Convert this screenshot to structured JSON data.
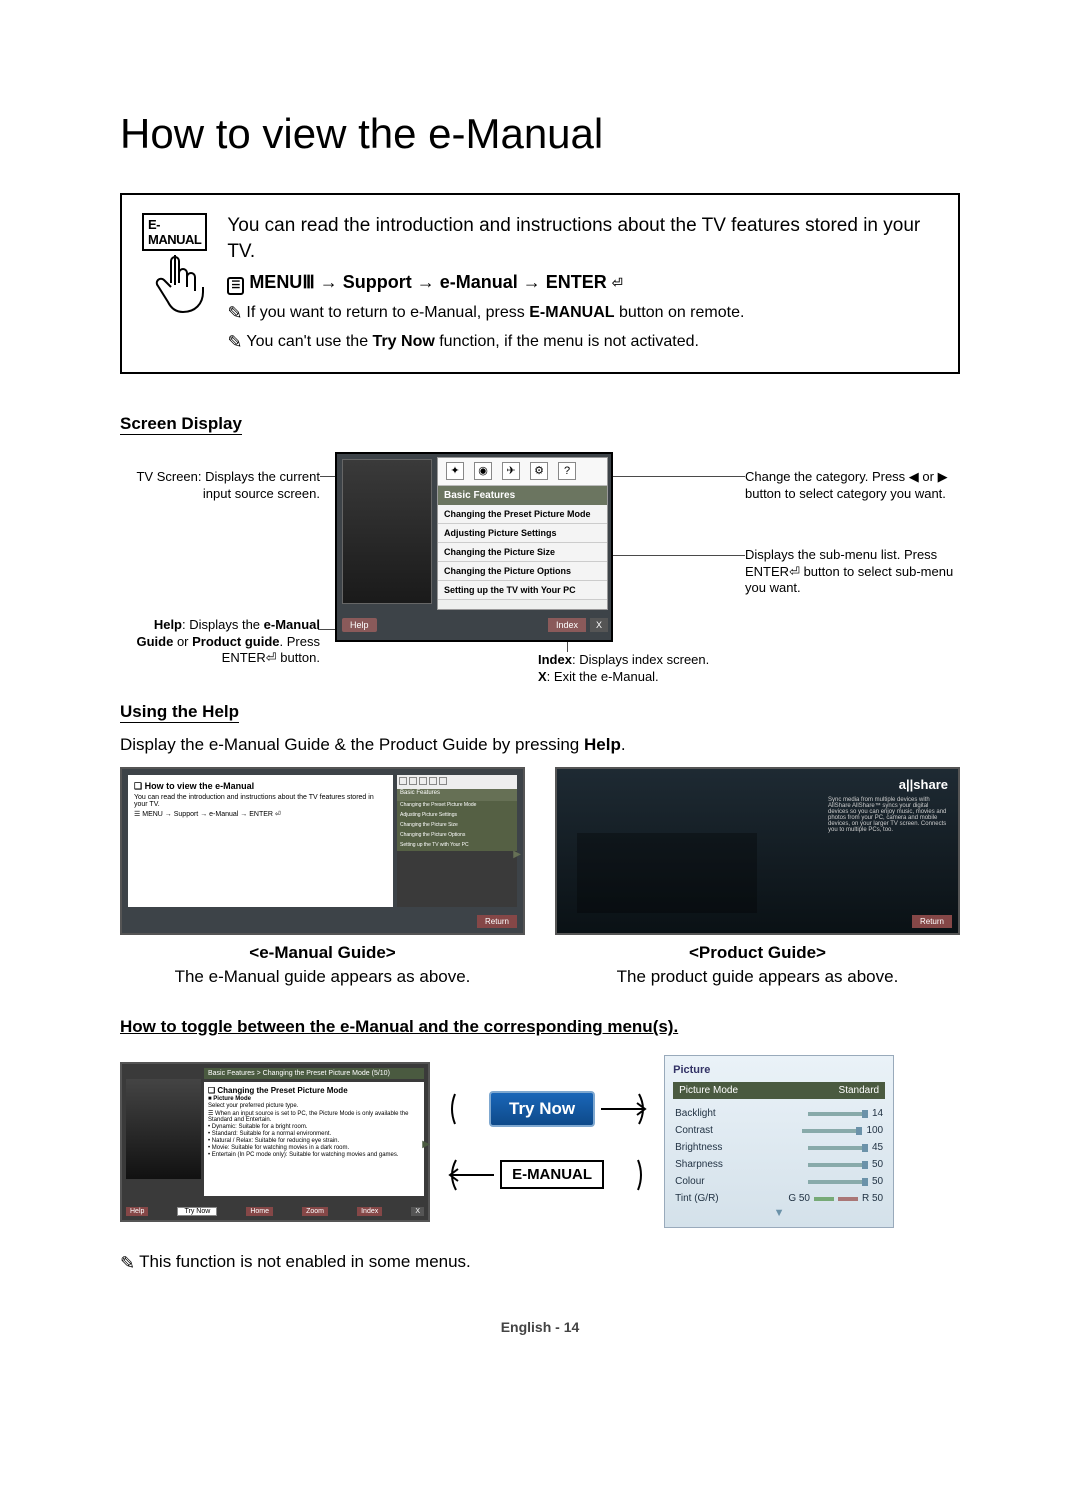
{
  "title": "How to view the e-Manual",
  "intro": {
    "badge": "E-MANUAL",
    "lead": "You can read the introduction and instructions about the TV features stored in your TV.",
    "path_menu": "MENU",
    "path_support": "Support",
    "path_emanual": "e-Manual",
    "path_enter": "ENTER",
    "note1_pre": "If you want to return to e-Manual, press ",
    "note1_b": "E-MANUAL",
    "note1_post": " button on remote.",
    "note2_pre": "You can't use the ",
    "note2_b": "Try Now",
    "note2_post": " function, if the menu is not activated."
  },
  "screen_display": {
    "heading": "Screen Display",
    "tvscreen_caption": "TV Screen: Displays the current input source screen.",
    "change_caption": "Change the category. Press ◀ or ▶ button to select category you want.",
    "submenu_caption_pre": "Displays the sub-menu list. Press ENTER",
    "submenu_caption_post": " button to select sub-menu you want.",
    "help_caption_html": [
      "Help",
      ": Displays the ",
      "e-Manual Guide",
      " or ",
      "Product guide",
      ". Press ENTER",
      " button."
    ],
    "index_caption_b": "Index",
    "index_caption": ": Displays index screen.",
    "x_caption_b": "X",
    "x_caption": ": Exit the e-Manual.",
    "bf_label": "Basic Features",
    "submenu_items": [
      "Changing the Preset Picture Mode",
      "Adjusting Picture Settings",
      "Changing the Picture Size",
      "Changing the Picture Options",
      "Setting up the TV with Your PC"
    ],
    "help_btn": "Help",
    "index_btn": "Index",
    "x_btn": "X"
  },
  "using_help": {
    "heading": "Using the Help",
    "desc_pre": "Display the e-Manual Guide & the Product Guide by pressing ",
    "desc_b": "Help",
    "desc_post": ".",
    "emg": {
      "box_title": "❏ How to view the e-Manual",
      "box_body": "You can read the introduction and instructions about the TV features stored in your TV.",
      "box_path": "MENU → Support → e-Manual → ENTER",
      "strip": "Basic Features",
      "rows": [
        "Changing the Preset Picture Mode",
        "Adjusting Picture Settings",
        "Changing the Picture Size",
        "Changing the Picture Options",
        "Setting up the TV with Your PC"
      ],
      "return_btn": "Return",
      "label": "<e-Manual Guide>",
      "desc": "The e-Manual guide appears as above."
    },
    "pg": {
      "brand": "a||share",
      "blurb": "Sync media from multiple devices with AllShare\nAllShare™ syncs your digital devices so you can enjoy music, movies and photos from your PC, camera and mobile devices, on your larger TV screen. Connects you to multiple PCs, too.",
      "return_btn": "Return",
      "label": "<Product Guide>",
      "desc": "The product guide appears as above."
    }
  },
  "toggle": {
    "heading": "How to toggle between the e-Manual and the corresponding menu(s).",
    "left_head": "Basic Features > Changing the Preset Picture Mode (5/10)",
    "left_h": "❏ Changing the Preset Picture Mode",
    "left_pm": "■ Picture Mode",
    "left_sel": "Select your preferred picture type.",
    "left_note": "When an input source is set to PC, the Picture Mode is only available the Standard and Entertain.",
    "left_bullets": [
      "Dynamic: Suitable for a bright room.",
      "Standard: Suitable for a normal environment.",
      "Natural / Relax: Suitable for reducing eye strain.",
      "Movie: Suitable for watching movies in a dark room.",
      "Entertain (In PC mode only): Suitable for watching movies and games."
    ],
    "left_btns": [
      "Help",
      "Try Now",
      "Home",
      "Zoom",
      "Index",
      "X"
    ],
    "try_now": "Try Now",
    "emanual": "E-MANUAL",
    "right": {
      "title": "Picture",
      "picmode_l": "Picture Mode",
      "picmode_v": "Standard",
      "rows": [
        {
          "l": "Backlight",
          "v": "14"
        },
        {
          "l": "Contrast",
          "v": "100"
        },
        {
          "l": "Brightness",
          "v": "45"
        },
        {
          "l": "Sharpness",
          "v": "50"
        },
        {
          "l": "Colour",
          "v": "50"
        }
      ],
      "tint_l": "Tint (G/R)",
      "tint_g": "G 50",
      "tint_r": "R 50"
    },
    "final_note": "This function is not enabled in some menus."
  },
  "footer": "English - 14"
}
